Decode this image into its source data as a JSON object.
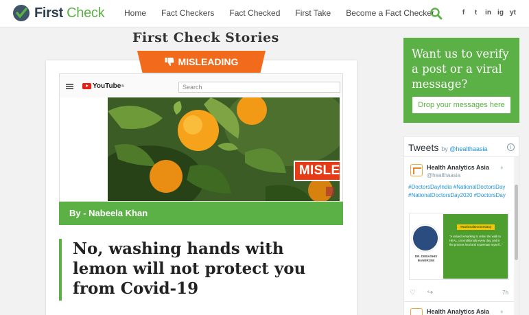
{
  "header": {
    "logo_first": "First",
    "logo_check": "Check",
    "nav": [
      "Home",
      "Fact Checkers",
      "Fact Checked",
      "First Take",
      "Become a Fact Checker"
    ],
    "social": [
      "f",
      "t",
      "in",
      "ig",
      "yt"
    ]
  },
  "main": {
    "section_title": "First Check Stories",
    "verdict": "MISLEADING",
    "video": {
      "site": "YouTube",
      "site_sup": "IN",
      "search_placeholder": "Search",
      "overlay_label": "MISLEADING"
    },
    "byline": "By - Nabeela Khan",
    "article_title": "No, washing hands with lemon will not protect you from Covid-19"
  },
  "sidebar": {
    "promo_text": "Want us to verify a post or a viral message?",
    "promo_button": "Drop your messages here",
    "tweets": {
      "title": "Tweets",
      "by": "by",
      "by_handle": "@healthaasia",
      "tweet1": {
        "name": "Health Analytics Asia",
        "handle": "@healthaasia",
        "hashtags": "#DoctorsDayIndia #NationalDoctorsDay #NationalDoctorsDay2020 #DoctorsDay",
        "media_person_name": "DR. DEBASHIS BANERJEE",
        "media_badge": "#NationalDoctorsDay",
        "media_quote": "\"A valued remarking to refine the walk to HEAL, unconditionally every day, and in the process heal and rejuvenate myself...\"",
        "time": "7h"
      },
      "tweet2": {
        "name": "Health Analytics Asia"
      }
    }
  }
}
